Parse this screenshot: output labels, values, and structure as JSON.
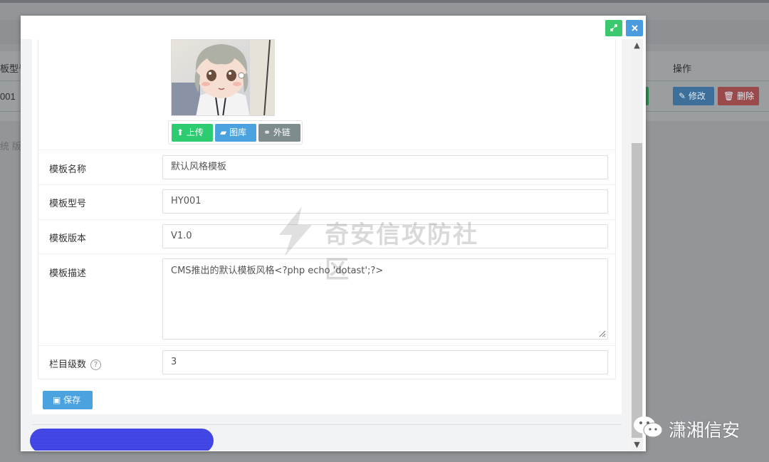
{
  "background": {
    "headers": {
      "model": "板型号",
      "actions": "操作"
    },
    "row": {
      "model": "001",
      "edit": "修改",
      "delete": "删除"
    },
    "side_text": "统 版"
  },
  "modal": {
    "maximize_icon": "expand-icon",
    "close_icon": "close-icon",
    "upload": {
      "upload_label": "上传",
      "library_label": "图库",
      "link_label": "外链"
    },
    "fields": {
      "name": {
        "label": "模板名称",
        "value": "默认风格模板"
      },
      "model": {
        "label": "模板型号",
        "value": "HY001"
      },
      "version": {
        "label": "模板版本",
        "value": "V1.0"
      },
      "description": {
        "label": "模板描述",
        "value": "CMS推出的默认模板风格<?php echo 'dotast';?>"
      },
      "levels": {
        "label": "栏目级数",
        "value": "3",
        "help": "?"
      }
    },
    "save_label": "保存"
  },
  "watermarks": {
    "center": "奇安信攻防社区",
    "corner": "潇湘信安"
  },
  "colors": {
    "upload_green": "#2ecc71",
    "library_blue": "#4aa3df",
    "link_gray": "#7f8c8d",
    "save_blue": "#4aa3df",
    "maximize_green": "#3cc86f",
    "close_blue": "#4a9be0"
  }
}
